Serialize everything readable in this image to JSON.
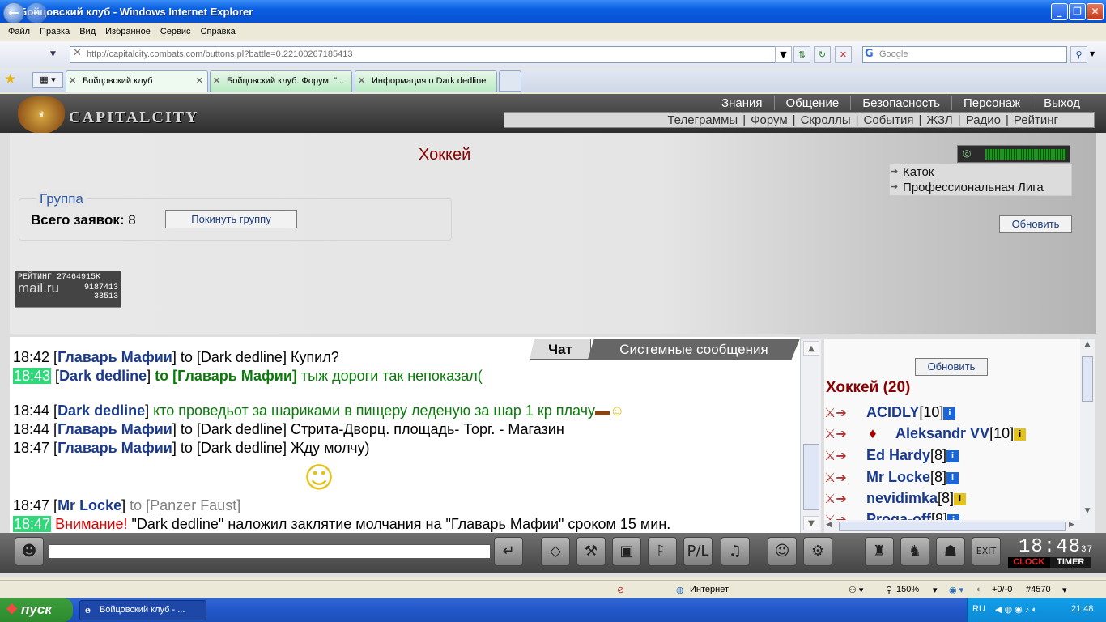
{
  "window": {
    "title": "Бойцовский клуб - Windows Internet Explorer"
  },
  "menu": [
    "Файл",
    "Правка",
    "Вид",
    "Избранное",
    "Сервис",
    "Справка"
  ],
  "address": {
    "url": "http://capitalcity.combats.com/buttons.pl?battle=0.22100267185413"
  },
  "search": {
    "placeholder": "Google"
  },
  "tabs": [
    {
      "label": "Бойцовский клуб"
    },
    {
      "label": "Бойцовский клуб. Форум: \"..."
    },
    {
      "label": "Информация о Dark dedline"
    }
  ],
  "site": {
    "logo_text": "CAPITALCITY",
    "topnav": [
      "Знания",
      "Общение",
      "Безопасность",
      "Персонаж",
      "Выход"
    ],
    "subnav": [
      "Телеграммы",
      "Форум",
      "Скроллы",
      "События",
      "ЖЗЛ",
      "Радио",
      "Рейтинг"
    ]
  },
  "main": {
    "title": "Хоккей",
    "group_legend": "Группа",
    "applications_label": "Всего заявок:",
    "applications_count": "8",
    "leave_button": "Покинуть группу",
    "links": [
      "Каток",
      "Профессиональная Лига"
    ],
    "refresh_button": "Обновить",
    "rating": {
      "label": "РЕЙТИНГ",
      "value1": "27464915K",
      "brand": "mail.ru",
      "value2": "9187413",
      "value3": "33513"
    }
  },
  "chat": {
    "tabs": [
      "Чат",
      "Системные сообщения"
    ],
    "lines": [
      {
        "time": "18:42",
        "from": "Главарь Мафии",
        "to": "Dark dedline",
        "text": "Купил?"
      },
      {
        "time": "18:43",
        "from": "Dark dedline",
        "to": "Главарь Мафии",
        "text": "тыж дороги так непоказал("
      },
      {
        "time": "18:44",
        "from": "Dark dedline",
        "text": "кто проведьот за шариками в пищеру леденую за шар 1 кр плачу"
      },
      {
        "time": "18:44",
        "from": "Главарь Мафии",
        "to": "Dark dedline",
        "text": "Стрита-Дворц. площадь- Торг. - Магазин"
      },
      {
        "time": "18:47",
        "from": "Главарь Мафии",
        "to": "Dark dedline",
        "text": "Жду молчу)"
      },
      {
        "time": "18:47",
        "from": "Mr Locke",
        "to": "Panzer Faust",
        "text": ""
      },
      {
        "time": "18:47",
        "warning": "Внимание!",
        "text": "\"Dark dedline\" наложил заклятие молчания на \"Главарь Мафии\" сроком 15 мин."
      }
    ],
    "to_word": "to"
  },
  "userlist": {
    "refresh_button": "Обновить",
    "title": "Хоккей (20)",
    "users": [
      {
        "name": "ACIDLY",
        "level": "[10]"
      },
      {
        "name": "Aleksandr VV",
        "level": "[10]"
      },
      {
        "name": "Ed Hardy",
        "level": "[8]"
      },
      {
        "name": "Mr Locke",
        "level": "[8]"
      },
      {
        "name": "nevidimka",
        "level": "[8]"
      },
      {
        "name": "Proga-off",
        "level": "[8]"
      }
    ]
  },
  "clock": {
    "time": "18:48",
    "seconds": "37",
    "clock_label": "CLOCK",
    "timer_label": "TIMER"
  },
  "statusbar": {
    "zone": "Интернет",
    "zoom": "150%",
    "counter": "+0/-0",
    "id": "#4570"
  },
  "taskbar": {
    "start": "пуск",
    "task": "Бойцовский клуб - ...",
    "lang": "RU",
    "time": "21:48"
  }
}
